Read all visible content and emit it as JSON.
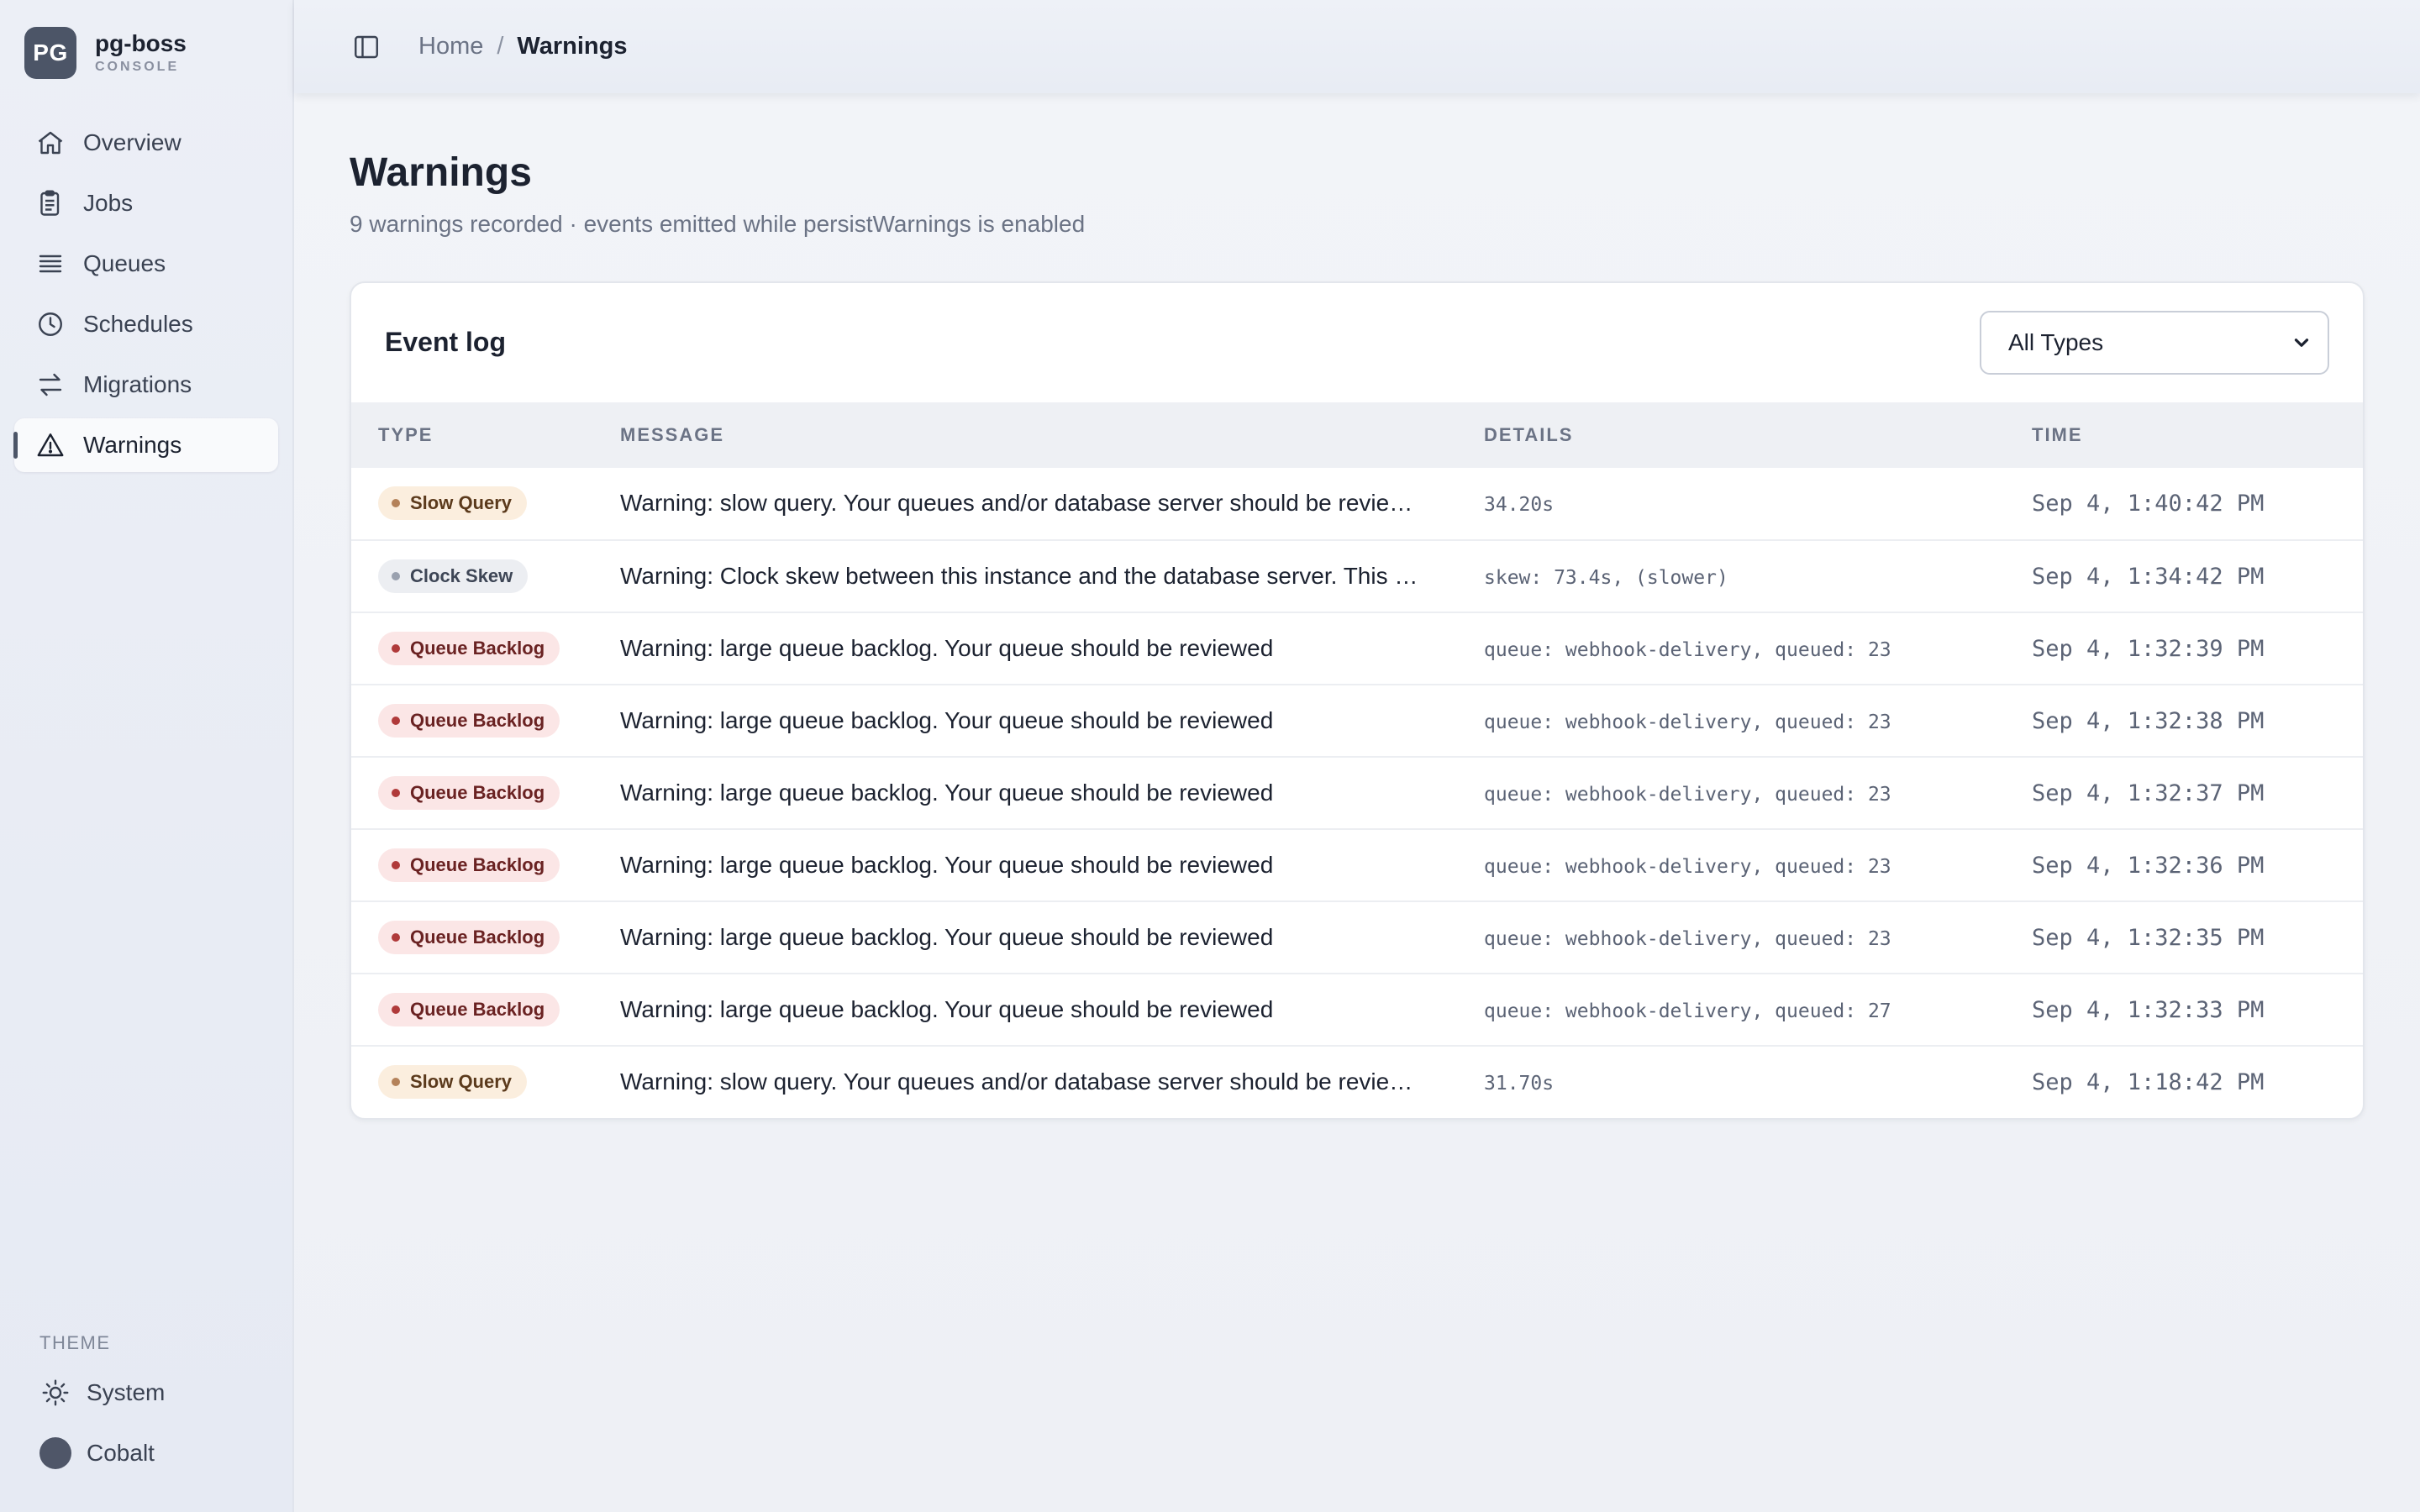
{
  "brand": {
    "logo": "PG",
    "name": "pg-boss",
    "sub": "CONSOLE"
  },
  "sidebar": {
    "items": [
      {
        "label": "Overview",
        "icon": "home-icon"
      },
      {
        "label": "Jobs",
        "icon": "clipboard-icon"
      },
      {
        "label": "Queues",
        "icon": "list-icon"
      },
      {
        "label": "Schedules",
        "icon": "clock-icon"
      },
      {
        "label": "Migrations",
        "icon": "arrows-icon"
      },
      {
        "label": "Warnings",
        "icon": "warning-icon",
        "active": true
      }
    ],
    "theme_label": "THEME",
    "theme_mode": "System",
    "theme_color": "Cobalt",
    "theme_swatch": "#4f5668"
  },
  "breadcrumb": {
    "home": "Home",
    "separator": "/",
    "current": "Warnings"
  },
  "page": {
    "title": "Warnings",
    "subtitle": "9 warnings recorded · events emitted while persistWarnings is enabled"
  },
  "event_log": {
    "title": "Event log",
    "filter_value": "All Types",
    "columns": {
      "type": "TYPE",
      "message": "MESSAGE",
      "details": "DETAILS",
      "time": "TIME"
    },
    "rows": [
      {
        "type": "Slow Query",
        "kind": "slow",
        "message": "Warning: slow query. Your queues and/or database server should be revie…",
        "details": "34.20s",
        "time": "Sep 4, 1:40:42 PM"
      },
      {
        "type": "Clock Skew",
        "kind": "clock",
        "message": "Warning: Clock skew between this instance and the database server. This …",
        "details": "skew: 73.4s, (slower)",
        "time": "Sep 4, 1:34:42 PM"
      },
      {
        "type": "Queue Backlog",
        "kind": "backlog",
        "message": "Warning: large queue backlog. Your queue should be reviewed",
        "details": "queue: webhook-delivery, queued: 23",
        "time": "Sep 4, 1:32:39 PM"
      },
      {
        "type": "Queue Backlog",
        "kind": "backlog",
        "message": "Warning: large queue backlog. Your queue should be reviewed",
        "details": "queue: webhook-delivery, queued: 23",
        "time": "Sep 4, 1:32:38 PM"
      },
      {
        "type": "Queue Backlog",
        "kind": "backlog",
        "message": "Warning: large queue backlog. Your queue should be reviewed",
        "details": "queue: webhook-delivery, queued: 23",
        "time": "Sep 4, 1:32:37 PM"
      },
      {
        "type": "Queue Backlog",
        "kind": "backlog",
        "message": "Warning: large queue backlog. Your queue should be reviewed",
        "details": "queue: webhook-delivery, queued: 23",
        "time": "Sep 4, 1:32:36 PM"
      },
      {
        "type": "Queue Backlog",
        "kind": "backlog",
        "message": "Warning: large queue backlog. Your queue should be reviewed",
        "details": "queue: webhook-delivery, queued: 23",
        "time": "Sep 4, 1:32:35 PM"
      },
      {
        "type": "Queue Backlog",
        "kind": "backlog",
        "message": "Warning: large queue backlog. Your queue should be reviewed",
        "details": "queue: webhook-delivery, queued: 27",
        "time": "Sep 4, 1:32:33 PM"
      },
      {
        "type": "Slow Query",
        "kind": "slow",
        "message": "Warning: slow query. Your queues and/or database server should be revie…",
        "details": "31.70s",
        "time": "Sep 4, 1:18:42 PM"
      }
    ]
  },
  "colors": {
    "accent": "#4c5567",
    "slow_badge_bg": "#fbeede",
    "clock_badge_bg": "#eceef2",
    "backlog_badge_bg": "#fbe6e6"
  }
}
